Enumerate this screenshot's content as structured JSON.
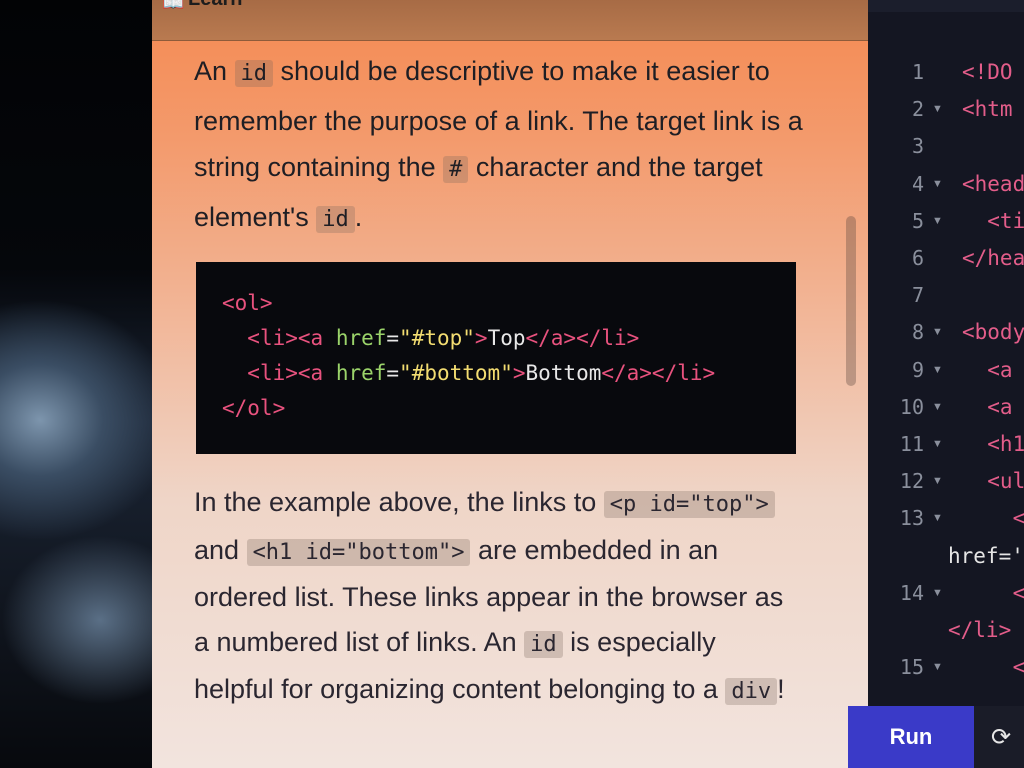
{
  "learn_panel": {
    "header_title": "Learn",
    "p1": [
      {
        "t": "text",
        "v": "An "
      },
      {
        "t": "code",
        "v": "id"
      },
      {
        "t": "text",
        "v": " should be descriptive to make it easier to remember the purpose of a link. The target link is a string containing the "
      },
      {
        "t": "code",
        "v": "#"
      },
      {
        "t": "text",
        "v": " character and the target element's "
      },
      {
        "t": "code",
        "v": "id"
      },
      {
        "t": "text",
        "v": "."
      }
    ],
    "code_lines": [
      [
        {
          "c": "tag",
          "v": "<ol>"
        }
      ],
      [
        {
          "c": "plain",
          "v": "  "
        },
        {
          "c": "tag",
          "v": "<li><a "
        },
        {
          "c": "attr",
          "v": "href"
        },
        {
          "c": "plain",
          "v": "="
        },
        {
          "c": "str",
          "v": "\"#top\""
        },
        {
          "c": "tag",
          "v": ">"
        },
        {
          "c": "plain",
          "v": "Top"
        },
        {
          "c": "tag",
          "v": "</a></li>"
        }
      ],
      [
        {
          "c": "plain",
          "v": "  "
        },
        {
          "c": "tag",
          "v": "<li><a "
        },
        {
          "c": "attr",
          "v": "href"
        },
        {
          "c": "plain",
          "v": "="
        },
        {
          "c": "str",
          "v": "\"#bottom\""
        },
        {
          "c": "tag",
          "v": ">"
        },
        {
          "c": "plain",
          "v": "Bottom"
        },
        {
          "c": "tag",
          "v": "</a></li>"
        }
      ],
      [
        {
          "c": "tag",
          "v": "</ol>"
        }
      ]
    ],
    "p2": [
      {
        "t": "text",
        "v": "In the example above, the links to "
      },
      {
        "t": "code",
        "v": "<p id=\"top\">"
      },
      {
        "t": "text",
        "v": " and "
      },
      {
        "t": "code",
        "v": "<h1 id=\"bottom\">"
      },
      {
        "t": "text",
        "v": " are embedded in an ordered list. These links appear in the browser as a numbered list of links. An "
      },
      {
        "t": "code",
        "v": "id"
      },
      {
        "t": "text",
        "v": " is especially helpful for organizing content belonging to a "
      },
      {
        "t": "code",
        "v": "div"
      },
      {
        "t": "text",
        "v": "!"
      }
    ]
  },
  "editor": {
    "lines": [
      {
        "n": "1",
        "fold": false,
        "code": "<!DO"
      },
      {
        "n": "2",
        "fold": true,
        "code": "<htm"
      },
      {
        "n": "3",
        "fold": false,
        "code": ""
      },
      {
        "n": "4",
        "fold": true,
        "code": "<head"
      },
      {
        "n": "5",
        "fold": true,
        "code": "  <ti"
      },
      {
        "n": "6",
        "fold": false,
        "code": "</hea"
      },
      {
        "n": "7",
        "fold": false,
        "code": ""
      },
      {
        "n": "8",
        "fold": true,
        "code": "<body"
      },
      {
        "n": "9",
        "fold": true,
        "code": "  <a"
      },
      {
        "n": "10",
        "fold": true,
        "code": "  <a"
      },
      {
        "n": "11",
        "fold": true,
        "code": "  <h1"
      },
      {
        "n": "12",
        "fold": true,
        "code": "  <ul"
      },
      {
        "n": "13",
        "fold": true,
        "code": "    <l"
      },
      {
        "n": "",
        "fold": false,
        "code": "href='"
      },
      {
        "n": "14",
        "fold": true,
        "code": "    <l"
      },
      {
        "n": "",
        "fold": false,
        "code": "</li>"
      },
      {
        "n": "15",
        "fold": true,
        "code": "    <l"
      }
    ],
    "run_label": "Run",
    "refresh_icon": "refresh-icon"
  }
}
